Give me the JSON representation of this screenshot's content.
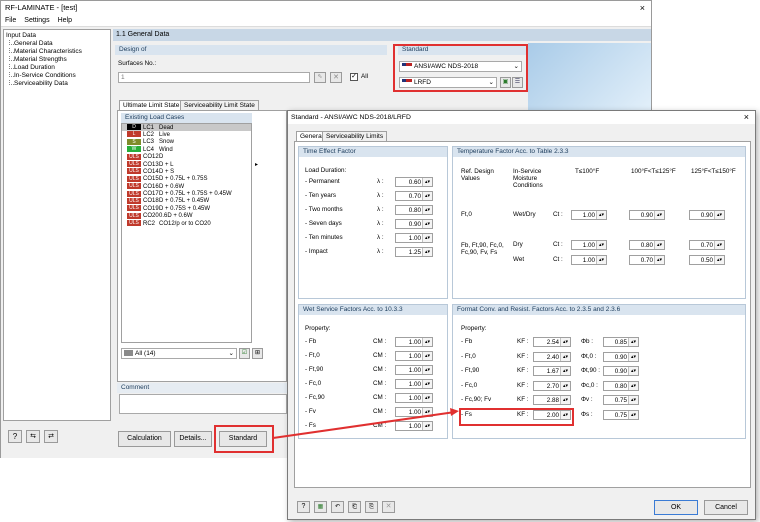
{
  "main_window": {
    "title": "RF-LAMINATE - [test]",
    "close": "×",
    "menu": [
      "File",
      "Settings",
      "Help"
    ],
    "tree": {
      "root": "Input Data",
      "items": [
        "General Data",
        "Material Characteristics",
        "Material Strengths",
        "Load Duration",
        "In-Service Conditions",
        "Serviceability Data"
      ]
    },
    "header": "1.1 General Data",
    "design_of": {
      "section": "Design of",
      "surfaces_label": "Surfaces No.:",
      "surfaces_value": "1",
      "all_label": "All"
    },
    "standard": {
      "section": "Standard",
      "standard_value": "ANSI/AWC NDS-2018",
      "method_value": "LRFD"
    },
    "tabs": [
      "Ultimate Limit State",
      "Serviceability Limit State"
    ],
    "existing_load_cases": {
      "title": "Existing Load Cases",
      "rows": [
        {
          "badge": "D",
          "badge_color": "#000000",
          "id": "LC1",
          "desc": "Dead"
        },
        {
          "badge": "L",
          "badge_color": "#c0392b",
          "id": "LC2",
          "desc": "Live"
        },
        {
          "badge": "S",
          "badge_color": "#7f8c2a",
          "id": "LC3",
          "desc": "Snow"
        },
        {
          "badge": "W",
          "badge_color": "#27ae3a",
          "id": "LC4",
          "desc": "Wind"
        },
        {
          "badge": "ULS",
          "badge_color": "#c0392b",
          "id": "CO12",
          "desc": "D"
        },
        {
          "badge": "ULS",
          "badge_color": "#c0392b",
          "id": "CO13",
          "desc": "D + L"
        },
        {
          "badge": "ULS",
          "badge_color": "#c0392b",
          "id": "CO14",
          "desc": "D + S"
        },
        {
          "badge": "ULS",
          "badge_color": "#c0392b",
          "id": "CO15",
          "desc": "D + 0.75L + 0.75S"
        },
        {
          "badge": "ULS",
          "badge_color": "#c0392b",
          "id": "CO16",
          "desc": "D + 0.6W"
        },
        {
          "badge": "ULS",
          "badge_color": "#c0392b",
          "id": "CO17",
          "desc": "D + 0.75L + 0.75S + 0.45W"
        },
        {
          "badge": "ULS",
          "badge_color": "#c0392b",
          "id": "CO18",
          "desc": "D + 0.75L + 0.45W"
        },
        {
          "badge": "ULS",
          "badge_color": "#c0392b",
          "id": "CO19",
          "desc": "D + 0.75S + 0.45W"
        },
        {
          "badge": "ULS",
          "badge_color": "#c0392b",
          "id": "CO20",
          "desc": "0.6D + 0.6W"
        },
        {
          "badge": "ULS",
          "badge_color": "#c0392b",
          "id": "RC2",
          "desc": "CO12/p or to CO20"
        }
      ],
      "filter": "All (14)"
    },
    "comment_label": "Comment",
    "buttons": {
      "calculation": "Calculation",
      "details": "Details...",
      "standard": "Standard"
    }
  },
  "dialog": {
    "title": "Standard - ANSI/AWC NDS-2018/LRFD",
    "close": "×",
    "tabs": [
      "General",
      "Serviceability Limits"
    ],
    "time_effect": {
      "title": "Time Effect Factor",
      "load_duration": "Load Duration:",
      "rows": [
        {
          "label": "- Permanent",
          "sym": "λ :",
          "value": "0.60"
        },
        {
          "label": "- Ten years",
          "sym": "λ :",
          "value": "0.70"
        },
        {
          "label": "- Two months",
          "sym": "λ :",
          "value": "0.80"
        },
        {
          "label": "- Seven days",
          "sym": "λ :",
          "value": "0.90"
        },
        {
          "label": "- Ten minutes",
          "sym": "λ :",
          "value": "1.00"
        },
        {
          "label": "- Impact",
          "sym": "λ :",
          "value": "1.25"
        }
      ]
    },
    "temperature": {
      "title": "Temperature Factor Acc. to Table 2.3.3",
      "col_ref": "Ref. Design Values",
      "col_moist": "In-Service Moisture Conditions",
      "col_t1": "T≤100°F",
      "col_t2": "100°F<T≤125°F",
      "col_t3": "125°F<T≤150°F",
      "rows": [
        {
          "ref": "Ft,0",
          "cond": "Wet/Dry",
          "sym": "Ct :",
          "v1": "1.00",
          "v2": "0.90",
          "v3": "0.90"
        },
        {
          "ref": "Fb, Ft,90, Fc,0, Fc,90, Fv, Fs",
          "cond": "Dry",
          "sym": "Ct :",
          "v1": "1.00",
          "v2": "0.80",
          "v3": "0.70"
        },
        {
          "ref": "",
          "cond": "Wet",
          "sym": "Ct :",
          "v1": "1.00",
          "v2": "0.70",
          "v3": "0.50"
        }
      ]
    },
    "wet_service": {
      "title": "Wet Service Factors Acc. to 10.3.3",
      "property": "Property:",
      "rows": [
        {
          "label": "- Fb",
          "sym": "CM :",
          "value": "1.00"
        },
        {
          "label": "- Ft,0",
          "sym": "CM :",
          "value": "1.00"
        },
        {
          "label": "- Ft,90",
          "sym": "CM :",
          "value": "1.00"
        },
        {
          "label": "- Fc,0",
          "sym": "CM :",
          "value": "1.00"
        },
        {
          "label": "- Fc,90",
          "sym": "CM :",
          "value": "1.00"
        },
        {
          "label": "- Fv",
          "sym": "CM :",
          "value": "1.00"
        },
        {
          "label": "- Fs",
          "sym": "CM :",
          "value": "1.00"
        }
      ]
    },
    "format_conv": {
      "title": "Format Conv. and Resist. Factors Acc. to 2.3.5 and 2.3.6",
      "property": "Property:",
      "rows": [
        {
          "label": "- Fb",
          "ksym": "KF :",
          "k": "2.54",
          "psym": "Φb :",
          "p": "0.85"
        },
        {
          "label": "- Ft,0",
          "ksym": "KF :",
          "k": "2.40",
          "psym": "Φt,0 :",
          "p": "0.90"
        },
        {
          "label": "- Ft,90",
          "ksym": "KF :",
          "k": "1.67",
          "psym": "Φt,90 :",
          "p": "0.90"
        },
        {
          "label": "- Fc,0",
          "ksym": "KF :",
          "k": "2.70",
          "psym": "Φc,0 :",
          "p": "0.80"
        },
        {
          "label": "- Fc,90; Fv",
          "ksym": "KF :",
          "k": "2.88",
          "psym": "Φv :",
          "p": "0.75"
        },
        {
          "label": "- Fs",
          "ksym": "KF :",
          "k": "2.00",
          "psym": "Φs :",
          "p": "0.75"
        }
      ]
    },
    "ok": "OK",
    "cancel": "Cancel"
  },
  "colors": {
    "highlight": "#e03030",
    "section": "#d9e4ef",
    "header": "#c8d7e6"
  }
}
